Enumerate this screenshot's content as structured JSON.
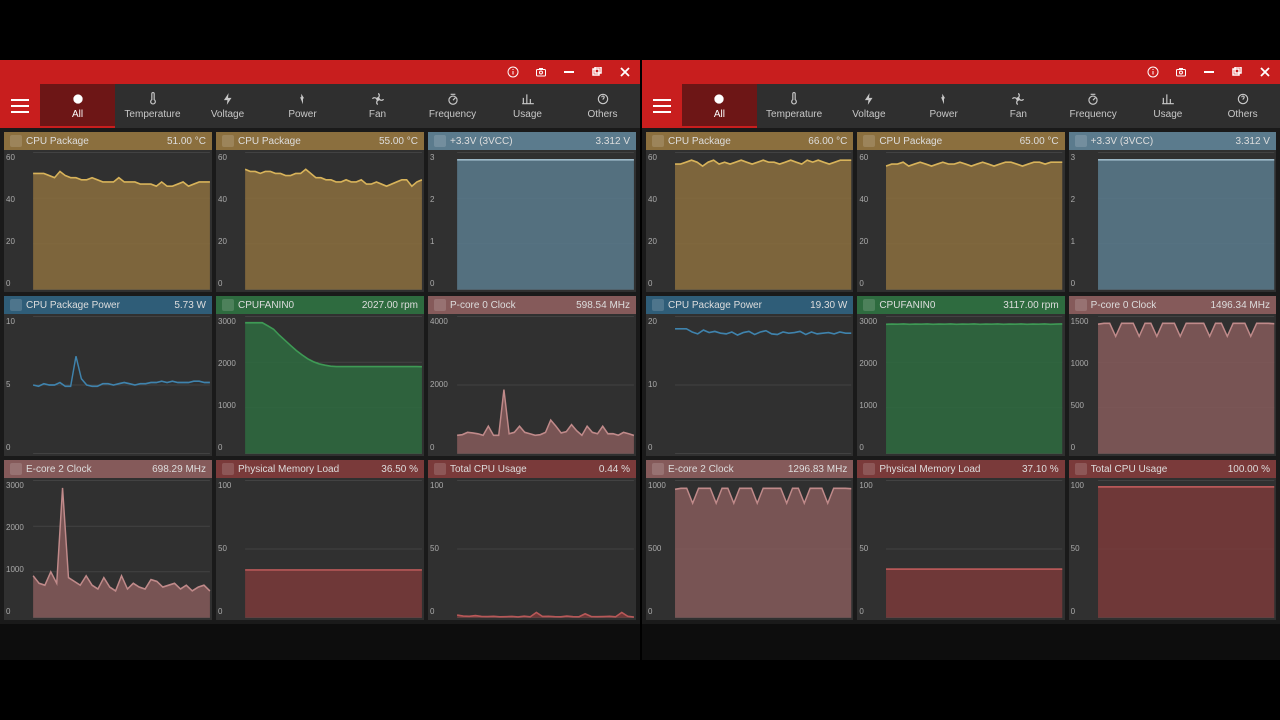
{
  "nav": {
    "tabs": [
      {
        "label": "All",
        "active": true
      },
      {
        "label": "Temperature"
      },
      {
        "label": "Voltage"
      },
      {
        "label": "Power"
      },
      {
        "label": "Fan"
      },
      {
        "label": "Frequency"
      },
      {
        "label": "Usage"
      },
      {
        "label": "Others"
      }
    ]
  },
  "panes": [
    {
      "cards": [
        {
          "label": "CPU Package",
          "value": "51.00 °C",
          "kind": "temp",
          "ticks": [
            "60",
            "40",
            "20",
            "0"
          ],
          "series": [
            55,
            55,
            55,
            54,
            53,
            56,
            54,
            53,
            53,
            52,
            52,
            53,
            52,
            51,
            51,
            51,
            53,
            51,
            51,
            51,
            50,
            50,
            50,
            49,
            51,
            49,
            49,
            50,
            51,
            49,
            50,
            51,
            51,
            51
          ],
          "ymax": 65,
          "fill": true
        },
        {
          "label": "CPU Package",
          "value": "55.00 °C",
          "kind": "temp",
          "ticks": [
            "60",
            "40",
            "20",
            "0"
          ],
          "series": [
            57,
            56,
            56,
            55,
            56,
            56,
            55,
            55,
            54,
            54,
            55,
            55,
            57,
            55,
            53,
            53,
            52,
            52,
            51,
            51,
            52,
            51,
            51,
            52,
            50,
            50,
            51,
            50,
            49,
            50,
            51,
            52,
            52,
            49,
            51,
            52
          ],
          "ymax": 65,
          "fill": true
        },
        {
          "label": "+3.3V (3VCC)",
          "value": "3.312 V",
          "kind": "volt",
          "ticks": [
            "3",
            "2",
            "1",
            "0"
          ],
          "series": [
            3.31,
            3.31,
            3.31,
            3.31,
            3.31,
            3.31,
            3.31,
            3.31,
            3.31,
            3.31,
            3.31,
            3.31,
            3.31,
            3.31,
            3.31,
            3.31,
            3.31,
            3.31,
            3.31,
            3.31,
            3.31,
            3.31,
            3.31,
            3.31,
            3.31,
            3.31,
            3.31,
            3.31,
            3.31,
            3.31
          ],
          "ymax": 3.5,
          "fill": true
        },
        {
          "label": "CPU Package Power",
          "value": "5.73 W",
          "kind": "power",
          "ticks": [
            "10",
            "5",
            "0"
          ],
          "series": [
            5.5,
            5.4,
            5.6,
            5.5,
            5.5,
            5.7,
            5.4,
            5.4,
            7.8,
            6.0,
            5.5,
            5.4,
            5.4,
            5.6,
            5.6,
            5.5,
            5.6,
            5.7,
            5.6,
            5.5,
            5.6,
            5.6,
            5.7,
            5.7,
            5.8,
            5.7,
            5.8,
            5.7,
            5.7,
            5.7,
            5.8,
            5.8,
            5.7,
            5.7
          ],
          "ymax": 11,
          "fill": false
        },
        {
          "label": "CPUFANIN0",
          "value": "2027.00 rpm",
          "kind": "fan",
          "ticks": [
            "3000",
            "2000",
            "1000",
            "0"
          ],
          "series": [
            3050,
            3050,
            3050,
            3050,
            2980,
            2900,
            2760,
            2640,
            2520,
            2400,
            2300,
            2210,
            2140,
            2090,
            2060,
            2040,
            2030,
            2030,
            2030,
            2030,
            2030,
            2030,
            2030,
            2030,
            2030,
            2030,
            2030,
            2030,
            2030,
            2030,
            2030,
            2027
          ],
          "ymax": 3200,
          "fill": true
        },
        {
          "label": "P-core 0 Clock",
          "value": "598.54 MHz",
          "kind": "freq",
          "ticks": [
            "4000",
            "2000",
            "0"
          ],
          "series": [
            600,
            620,
            700,
            680,
            650,
            600,
            900,
            600,
            600,
            2100,
            650,
            700,
            900,
            700,
            650,
            600,
            620,
            700,
            1100,
            900,
            680,
            720,
            950,
            750,
            600,
            900,
            700,
            650,
            900,
            650,
            650,
            600,
            700,
            650,
            598
          ],
          "ymax": 4500,
          "fill": true
        },
        {
          "label": "E-core 2 Clock",
          "value": "698.29 MHz",
          "kind": "freq",
          "ticks": [
            "3000",
            "2000",
            "1000",
            "0"
          ],
          "series": [
            1100,
            900,
            850,
            1200,
            900,
            3400,
            1050,
            950,
            850,
            1100,
            850,
            750,
            1050,
            800,
            700,
            1100,
            750,
            900,
            800,
            750,
            1000,
            950,
            800,
            850,
            900,
            750,
            850,
            700,
            800,
            850,
            698
          ],
          "ymax": 3600,
          "fill": true
        },
        {
          "label": "Physical Memory Load",
          "value": "36.50 %",
          "kind": "usage",
          "ticks": [
            "100",
            "50",
            "0"
          ],
          "series": [
            36.5,
            36.5,
            36.5,
            36.5,
            36.5,
            36.5,
            36.5,
            36.5,
            36.5,
            36.5,
            36.5,
            36.5,
            36.5,
            36.5,
            36.5,
            36.5,
            36.5,
            36.5,
            36.5,
            36.5,
            36.5,
            36.5,
            36.5,
            36.5,
            36.5,
            36.5,
            36.5,
            36.5,
            36.5,
            36.5
          ],
          "ymax": 105,
          "fill": true
        },
        {
          "label": "Total CPU Usage",
          "value": "0.44 %",
          "kind": "usage",
          "ticks": [
            "100",
            "50",
            "0"
          ],
          "series": [
            2,
            1.2,
            1,
            1.5,
            0.9,
            0.8,
            1,
            0.6,
            0.7,
            0.9,
            0.5,
            1.1,
            0.6,
            4,
            0.9,
            1,
            0.7,
            0.6,
            1.2,
            0.7,
            0.6,
            3,
            0.8,
            0.7,
            0.8,
            1,
            0.6,
            4,
            1,
            0.44
          ],
          "ymax": 105,
          "fill": true
        }
      ]
    },
    {
      "cards": [
        {
          "label": "CPU Package",
          "value": "66.00 °C",
          "kind": "temp",
          "ticks": [
            "60",
            "40",
            "20",
            "0"
          ],
          "series": [
            64,
            64,
            65,
            66,
            65,
            63,
            65,
            66,
            64,
            65,
            64,
            65,
            66,
            65,
            64,
            65,
            66,
            65,
            65,
            64,
            65,
            66,
            65,
            64,
            66,
            65,
            66,
            65,
            64,
            65,
            66,
            66,
            66
          ],
          "ymax": 70,
          "fill": true
        },
        {
          "label": "CPU Package",
          "value": "65.00 °C",
          "kind": "temp",
          "ticks": [
            "60",
            "40",
            "20",
            "0"
          ],
          "series": [
            63,
            64,
            64,
            65,
            63,
            64,
            65,
            64,
            63,
            64,
            65,
            64,
            64,
            65,
            64,
            63,
            64,
            65,
            64,
            63,
            64,
            65,
            65,
            64,
            63,
            64,
            65,
            65,
            64,
            65,
            65,
            65
          ],
          "ymax": 70,
          "fill": true
        },
        {
          "label": "+3.3V (3VCC)",
          "value": "3.312 V",
          "kind": "volt",
          "ticks": [
            "3",
            "2",
            "1",
            "0"
          ],
          "series": [
            3.31,
            3.31,
            3.31,
            3.31,
            3.31,
            3.31,
            3.31,
            3.31,
            3.31,
            3.31,
            3.31,
            3.31,
            3.31,
            3.31,
            3.31,
            3.31,
            3.31,
            3.31,
            3.31,
            3.31,
            3.31,
            3.31,
            3.31,
            3.31,
            3.31,
            3.31,
            3.31,
            3.31,
            3.31,
            3.31
          ],
          "ymax": 3.5,
          "fill": true
        },
        {
          "label": "CPU Package Power",
          "value": "19.30 W",
          "kind": "power",
          "ticks": [
            "20",
            "10",
            "0"
          ],
          "series": [
            20,
            20,
            20,
            19.5,
            19.2,
            19.8,
            19.4,
            19.6,
            19.3,
            19.2,
            19.5,
            19.0,
            19.4,
            19.6,
            19.1,
            19.5,
            19.7,
            19.2,
            19.1,
            19.5,
            19.3,
            19.4,
            19.6,
            19.1,
            19.5,
            19.2,
            19.3,
            19.4,
            19.2,
            19.5,
            19.3,
            19.3
          ],
          "ymax": 22,
          "fill": false
        },
        {
          "label": "CPUFANIN0",
          "value": "3117.00 rpm",
          "kind": "fan",
          "ticks": [
            "3000",
            "2000",
            "1000",
            "0"
          ],
          "series": [
            3110,
            3115,
            3112,
            3118,
            3110,
            3115,
            3112,
            3118,
            3110,
            3115,
            3112,
            3118,
            3110,
            3115,
            3112,
            3118,
            3110,
            3115,
            3112,
            3118,
            3110,
            3115,
            3112,
            3118,
            3110,
            3115,
            3112,
            3118,
            3110,
            3115,
            3117
          ],
          "ymax": 3300,
          "fill": true
        },
        {
          "label": "P-core 0 Clock",
          "value": "1496.34 MHz",
          "kind": "freq",
          "ticks": [
            "1500",
            "1000",
            "500",
            "0"
          ],
          "series": [
            1490,
            1500,
            1500,
            1350,
            1500,
            1500,
            1500,
            1350,
            1500,
            1500,
            1350,
            1500,
            1500,
            1500,
            1350,
            1500,
            1500,
            1500,
            1500,
            1350,
            1500,
            1500,
            1350,
            1500,
            1500,
            1500,
            1350,
            1500,
            1500,
            1500,
            1496
          ],
          "ymax": 1580,
          "fill": true
        },
        {
          "label": "E-core 2 Clock",
          "value": "1296.83 MHz",
          "kind": "freq",
          "ticks": [
            "1000",
            "500",
            "0"
          ],
          "series": [
            1290,
            1300,
            1300,
            1150,
            1300,
            1300,
            1300,
            1150,
            1300,
            1300,
            1150,
            1300,
            1300,
            1300,
            1150,
            1300,
            1300,
            1300,
            1300,
            1150,
            1300,
            1300,
            1150,
            1300,
            1300,
            1300,
            1150,
            1300,
            1300,
            1300,
            1297
          ],
          "ymax": 1380,
          "fill": true
        },
        {
          "label": "Physical Memory Load",
          "value": "37.10 %",
          "kind": "usage",
          "ticks": [
            "100",
            "50",
            "0"
          ],
          "series": [
            37.1,
            37.1,
            37.1,
            37.1,
            37.1,
            37.1,
            37.1,
            37.1,
            37.1,
            37.1,
            37.1,
            37.1,
            37.1,
            37.1,
            37.1,
            37.1,
            37.1,
            37.1,
            37.1,
            37.1,
            37.1,
            37.1,
            37.1,
            37.1,
            37.1,
            37.1,
            37.1,
            37.1,
            37.1,
            37.1
          ],
          "ymax": 105,
          "fill": true
        },
        {
          "label": "Total CPU Usage",
          "value": "100.00 %",
          "kind": "usage",
          "ticks": [
            "100",
            "50",
            "0"
          ],
          "series": [
            100,
            100,
            100,
            100,
            100,
            100,
            100,
            100,
            100,
            100,
            100,
            100,
            100,
            100,
            100,
            100,
            100,
            100,
            100,
            100,
            100,
            100,
            100,
            100,
            100,
            100,
            100,
            100,
            100,
            100
          ],
          "ymax": 105,
          "fill": true
        }
      ]
    }
  ],
  "colors": {
    "temp": {
      "stroke": "#d8b35a",
      "fill": "#8b6f3e"
    },
    "volt": {
      "stroke": "#9cb8c7",
      "fill": "#5b7b8d"
    },
    "power": {
      "stroke": "#3f83ad",
      "fill": "#2f5d78"
    },
    "fan": {
      "stroke": "#3e9a55",
      "fill": "#2e6b3f"
    },
    "freq": {
      "stroke": "#c08a8a",
      "fill": "#855a5a"
    },
    "usage": {
      "stroke": "#b85858",
      "fill": "#7a3a3a"
    }
  },
  "chart_data": {
    "type": "line",
    "note": "Two side-by-side monitoring dashboards. Each contains a 3×3 grid of live metric sparkline charts.",
    "panels": "see panes[].cards[].series for per-chart data; ymax gives chart axis upper bound; ticks are y-axis labels"
  }
}
